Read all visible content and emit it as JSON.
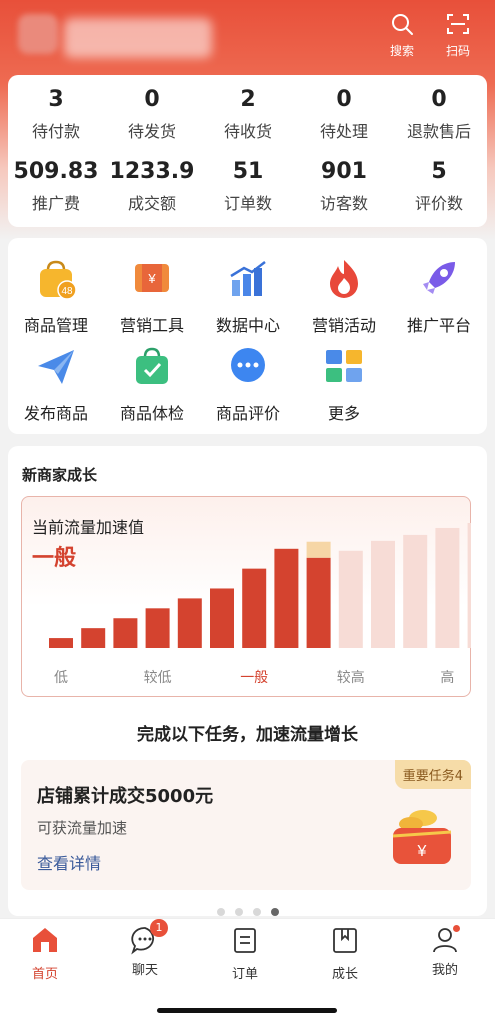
{
  "header": {
    "search_label": "搜索",
    "scan_label": "扫码"
  },
  "stats": {
    "row1": [
      {
        "value": "3",
        "label": "待付款"
      },
      {
        "value": "0",
        "label": "待发货"
      },
      {
        "value": "2",
        "label": "待收货"
      },
      {
        "value": "0",
        "label": "待处理"
      },
      {
        "value": "0",
        "label": "退款售后"
      }
    ],
    "row2": [
      {
        "value": "509.83",
        "label": "推广费"
      },
      {
        "value": "1233.9",
        "label": "成交额"
      },
      {
        "value": "51",
        "label": "订单数"
      },
      {
        "value": "901",
        "label": "访客数"
      },
      {
        "value": "5",
        "label": "评价数"
      }
    ]
  },
  "tools": [
    {
      "label": "商品管理",
      "icon": "shopping-bag-icon",
      "badge": "48"
    },
    {
      "label": "营销工具",
      "icon": "coupon-icon"
    },
    {
      "label": "数据中心",
      "icon": "bar-chart-icon"
    },
    {
      "label": "营销活动",
      "icon": "flame-icon"
    },
    {
      "label": "推广平台",
      "icon": "rocket-icon"
    },
    {
      "label": "发布商品",
      "icon": "paper-plane-icon"
    },
    {
      "label": "商品体检",
      "icon": "check-bag-icon"
    },
    {
      "label": "商品评价",
      "icon": "chat-bubble-icon"
    },
    {
      "label": "更多",
      "icon": "more-grid-icon"
    }
  ],
  "growth": {
    "title": "新商家成长",
    "flow_label": "当前流量加速值",
    "flow_value": "一般",
    "tasks_heading": "完成以下任务，加速流量增长",
    "task": {
      "badge": "重要任务4",
      "title": "店铺累计成交5000元",
      "subtitle": "可获流量加速",
      "link": "查看详情"
    },
    "pager": {
      "count": 4,
      "active": 3
    }
  },
  "chart_data": {
    "type": "bar",
    "categories": [
      "",
      "",
      "",
      "",
      "",
      "",
      "",
      "",
      "",
      "",
      "",
      "",
      "",
      ""
    ],
    "tick_labels": [
      "低",
      "较低",
      "一般",
      "较高",
      "高"
    ],
    "tick_positions": [
      0,
      3,
      6,
      9,
      12
    ],
    "current_tick": 2,
    "values": [
      1,
      2,
      3,
      4,
      5,
      6,
      8,
      10,
      9.1,
      9.8,
      10.8,
      11.4,
      12.1,
      12.6
    ],
    "filled_count": 9,
    "highlight_index": 8,
    "colors": {
      "active": "#d4432f",
      "inactive": "#f7dcd6",
      "highlight": "#f6d6a6",
      "tick_current": "#d4432f",
      "tick": "#888888"
    }
  },
  "nav": [
    {
      "label": "首页",
      "icon": "home-icon",
      "active": true
    },
    {
      "label": "聊天",
      "icon": "chat-icon",
      "badge": "1"
    },
    {
      "label": "订单",
      "icon": "order-icon"
    },
    {
      "label": "成长",
      "icon": "growth-icon"
    },
    {
      "label": "我的",
      "icon": "profile-icon",
      "dot": true
    }
  ],
  "colors": {
    "brand": "#e8503a",
    "accent_red": "#d4432f",
    "link_blue": "#3a5a9a"
  }
}
